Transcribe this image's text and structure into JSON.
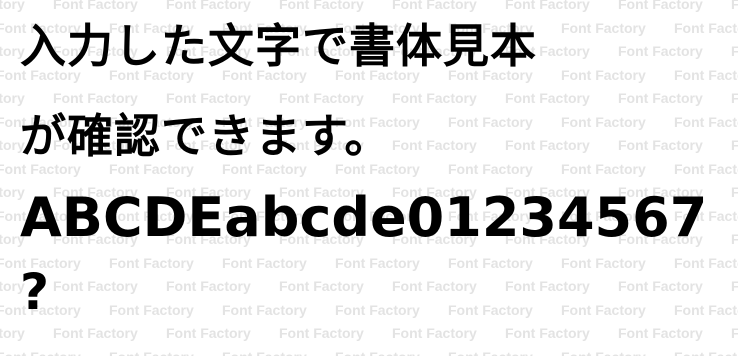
{
  "watermark": {
    "text": "Font Factory"
  },
  "specimen": {
    "line1": "入力した文字で書体見本",
    "line2": "が確認できます。",
    "line3": "ABCDEabcde01234567",
    "line4": "?"
  }
}
